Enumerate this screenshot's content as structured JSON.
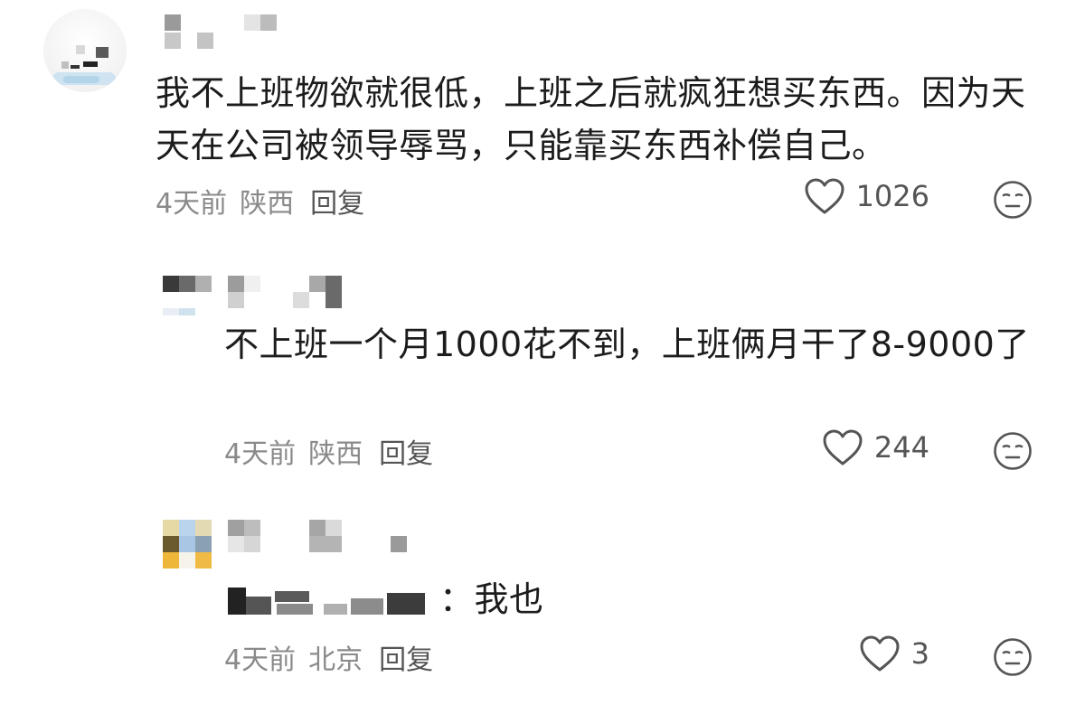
{
  "main_comment": {
    "text": "我不上班物欲就很低，上班之后就疯狂想买东西。因为天天在公司被领导辱骂，只能靠买东西补偿自己。",
    "time": "4天前",
    "location": "陕西",
    "reply_label": "回复",
    "likes": "1026",
    "like_icon": "heart-outline-icon",
    "dislike_icon": "neutral-face-icon"
  },
  "replies": [
    {
      "text": "不上班一个月1000花不到，上班俩月干了8-9000了",
      "time": "4天前",
      "location": "陕西",
      "reply_label": "回复",
      "likes": "244"
    },
    {
      "text_suffix": "：我也",
      "time": "4天前",
      "location": "北京",
      "reply_label": "回复",
      "likes": "3"
    }
  ],
  "colors": {
    "text": "#1c1c1c",
    "meta": "#8a8a8a",
    "icon": "#555555",
    "background": "#ffffff"
  }
}
